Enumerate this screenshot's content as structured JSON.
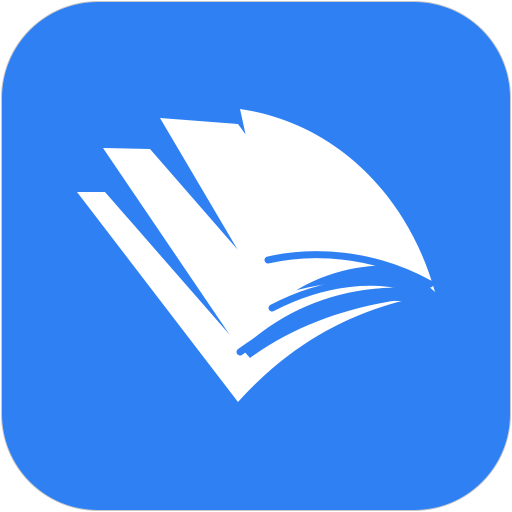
{
  "app_icon": {
    "icon_name": "book-pages-icon",
    "colors": {
      "background": "#2f80f2",
      "glyph": "#ffffff"
    }
  }
}
